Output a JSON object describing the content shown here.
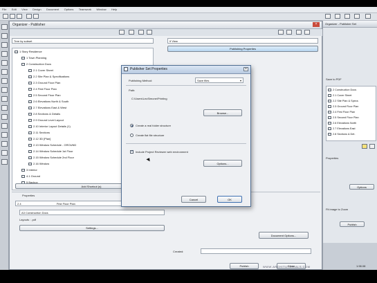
{
  "app": {
    "menu": [
      "File",
      "Edit",
      "View",
      "Design",
      "Document",
      "Options",
      "Teamwork",
      "Window",
      "Help"
    ]
  },
  "organizer": {
    "title": "Organizer - Publisher",
    "left_view": "Tree by subset",
    "right_view": "If View",
    "publishing_tab": "Publishing Properties",
    "tree": [
      {
        "label": "1 Story Residence",
        "indent": 0
      },
      {
        "label": "1 Town Planning",
        "indent": 1
      },
      {
        "label": "2 Construction Docs",
        "indent": 1
      },
      {
        "label": "2.1 Cover Sheet",
        "indent": 2
      },
      {
        "label": "2.2 Site Plan & Specifications",
        "indent": 2
      },
      {
        "label": "2.3 Ground Floor Plan",
        "indent": 2
      },
      {
        "label": "2.4 First Floor Plan",
        "indent": 2
      },
      {
        "label": "2.5 Second Floor Plan",
        "indent": 2
      },
      {
        "label": "2.6 Elevations North & South",
        "indent": 2
      },
      {
        "label": "2.7 Elevations East & West",
        "indent": 2
      },
      {
        "label": "2.8 Sections & Details",
        "indent": 2
      },
      {
        "label": "2.9 Ground Level Layout",
        "indent": 2
      },
      {
        "label": "2.10 Interior Layout Details (1)",
        "indent": 2
      },
      {
        "label": "2.11 Sections",
        "indent": 2
      },
      {
        "label": "2.12 3D [Plan]",
        "indent": 2
      },
      {
        "label": "2.13 Window Schedule - GROUND",
        "indent": 2
      },
      {
        "label": "2.14 Window Schedule 1st Floor",
        "indent": 2
      },
      {
        "label": "2.15 Window Schedule 2nd Floor",
        "indent": 2
      },
      {
        "label": "2.16 Window",
        "indent": 2
      },
      {
        "label": "3 Interior",
        "indent": 1
      },
      {
        "label": "4.1 Ground",
        "indent": 1
      },
      {
        "label": "5 Backup",
        "indent": 1
      }
    ],
    "add_shortcut_btn": "Add Shortcut (s)",
    "properties_label": "Properties",
    "prop_id": "2.4",
    "prop_name": "First Floor Plan",
    "path_field": "A3 Construction Docs",
    "format_label": "Layouts  :  .pdf",
    "settings_btn": "Settings...",
    "document_options_btn": "Document Options...",
    "created_label": "Created:",
    "publish_btn": "Publish",
    "close_btn": "Close"
  },
  "dialog": {
    "title": "Publisher Set Properties",
    "publishing_method_label": "Publishing Method:",
    "publishing_method_value": "Save files",
    "path_label": "Path:",
    "path_value": "C:\\Users\\LeoSimone\\Printing",
    "browse_btn": "Browse...",
    "radio_real_folder": "Create a real folder structure",
    "radio_flat_file": "Create flat file structure",
    "include_checkbox": "Include Project Reviewer web environment",
    "options_btn": "Options...",
    "cancel_btn": "Cancel",
    "ok_btn": "OK"
  },
  "publisher_panel": {
    "title": "Organizer - Publisher Set",
    "subtitle": "Save to PDF",
    "items": [
      "2 Construction Docs",
      "2.1 Cover Sheet",
      "2.2 Site Plan & Specs",
      "2.3 Ground Floor Plan",
      "2.4 First Floor Plan",
      "2.5 Second Floor Plan",
      "2.6 Elevations North",
      "2.7 Elevations East",
      "2.8 Sections & Det."
    ],
    "properties_label": "Properties",
    "options_btn": "Options",
    "publish_btn": "Publish",
    "zoom_hint": "Fit image to Zoom",
    "status": "1:98.08"
  },
  "watermark": "WWW.ARCHITUTORIALS.COM"
}
